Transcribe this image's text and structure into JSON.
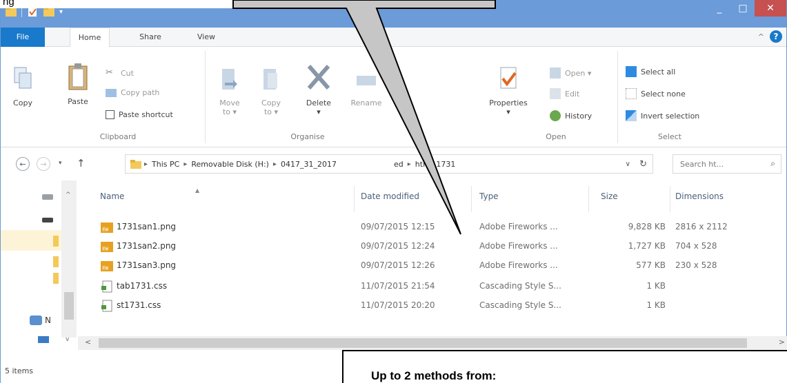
{
  "overlay": {
    "top_caption": "ng",
    "callout_text": "Up to 2 methods from:"
  },
  "window": {
    "controls": [
      "_",
      "□",
      "✕"
    ]
  },
  "ribbon_tabs": [
    "File",
    "Home",
    "Share",
    "View"
  ],
  "clipboard": {
    "copy": "Copy",
    "paste": "Paste",
    "cut": "Cut",
    "copy_path": "Copy path",
    "paste_shortcut": "Paste shortcut",
    "label": "Clipboard"
  },
  "organise": {
    "move_to": "Move\nto ▾",
    "move_to_line1": "Move",
    "move_to_line2": "to ▾",
    "copy_to_line1": "Copy",
    "copy_to_line2": "to ▾",
    "delete_line1": "Delete",
    "delete_line2": "▾",
    "rename": "Rename",
    "label": "Organise"
  },
  "open": {
    "properties_line1": "Properties",
    "properties_line2": "▾",
    "open": "Open ▾",
    "edit": "Edit",
    "history": "History",
    "label": "Open"
  },
  "select": {
    "select_all": "Select all",
    "select_none": "Select none",
    "invert_selection": "Invert selection",
    "label": "Select"
  },
  "address": {
    "crumbs": [
      "This PC",
      "Removable Disk (H:)",
      "0417_31_2017",
      "ed",
      "html_1731"
    ],
    "refresh_icon": "refresh-icon"
  },
  "search": {
    "placeholder": "Search ht..."
  },
  "columns": {
    "name": "Name",
    "date_modified": "Date modified",
    "type": "Type",
    "size": "Size",
    "dimensions": "Dimensions"
  },
  "files": [
    {
      "name": "1731san1.png",
      "date": "09/07/2015 12:15",
      "type": "Adobe Fireworks ...",
      "size": "9,828 KB",
      "dimensions": "2816 x 2112",
      "icon": "fireworks-png"
    },
    {
      "name": "1731san2.png",
      "date": "09/07/2015 12:24",
      "type": "Adobe Fireworks ...",
      "size": "1,727 KB",
      "dimensions": "704 x 528",
      "icon": "fireworks-png"
    },
    {
      "name": "1731san3.png",
      "date": "09/07/2015 12:26",
      "type": "Adobe Fireworks ...",
      "size": "577 KB",
      "dimensions": "230 x 528",
      "icon": "fireworks-png"
    },
    {
      "name": "tab1731.css",
      "date": "11/07/2015 21:54",
      "type": "Cascading Style S...",
      "size": "1 KB",
      "dimensions": "",
      "icon": "css-file"
    },
    {
      "name": "st1731.css",
      "date": "11/07/2015 20:20",
      "type": "Cascading Style S...",
      "size": "1 KB",
      "dimensions": "",
      "icon": "css-file"
    }
  ],
  "nav_pane": {
    "network_partial": "N"
  },
  "status": {
    "items": "5 items"
  },
  "colors": {
    "titlebar": "#6b9bd8",
    "file_tab": "#1979ca",
    "close_button": "#c75050",
    "fireworks_icon": "#e8a020"
  }
}
